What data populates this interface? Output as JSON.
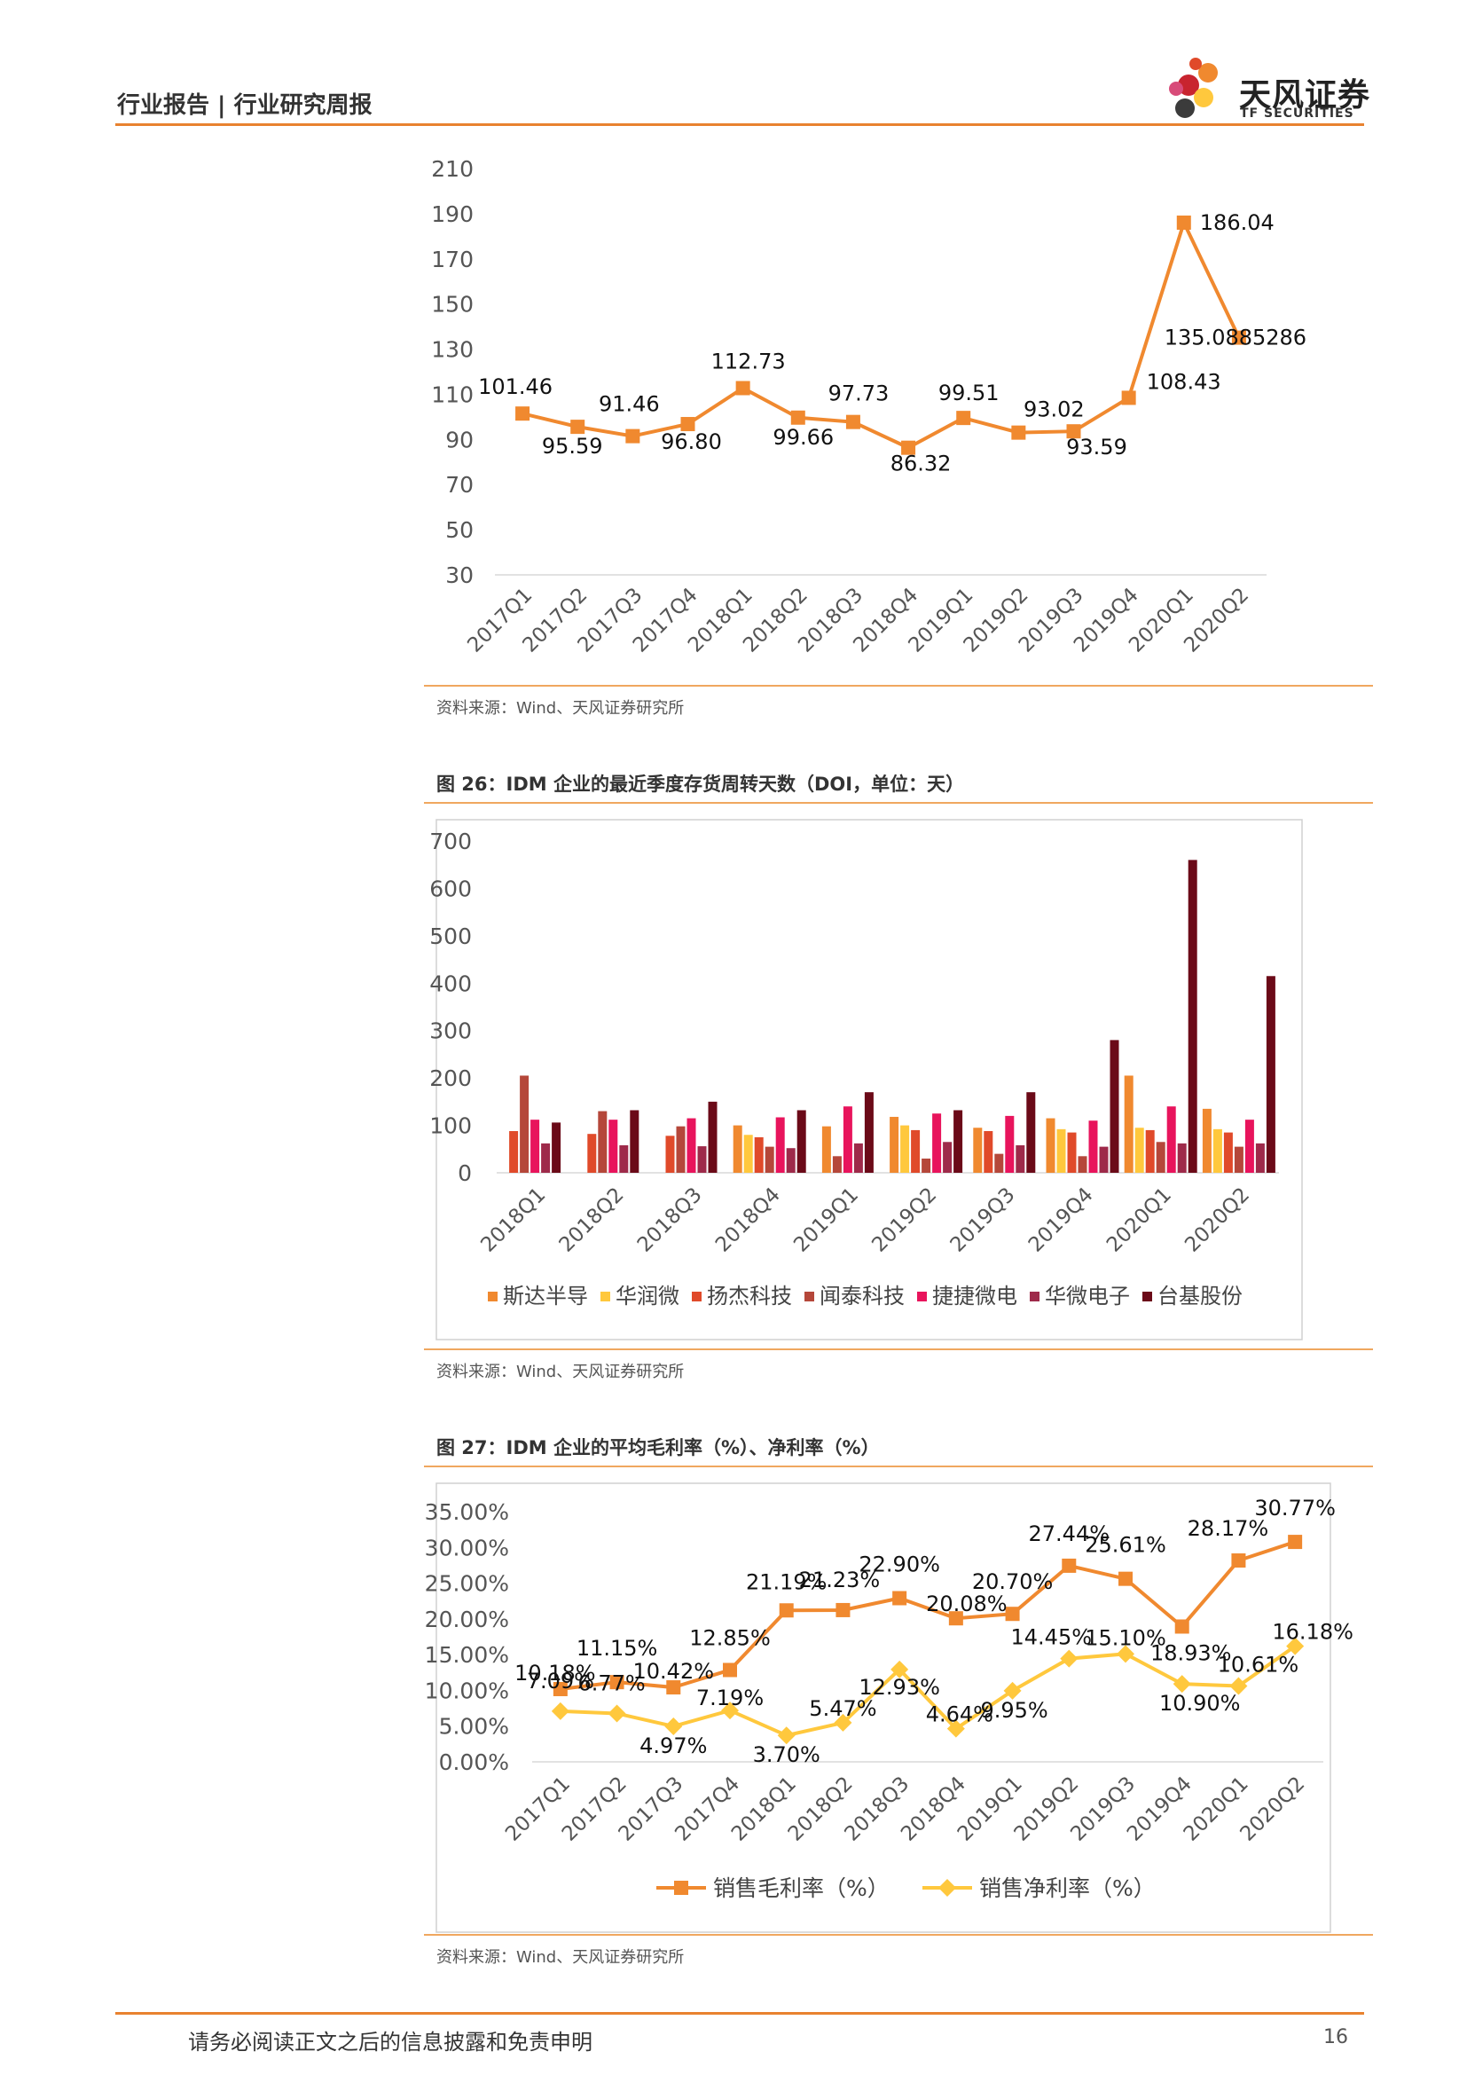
{
  "header": {
    "title": "行业报告 | 行业研究周报",
    "brand_cn": "天风证券",
    "brand_en": "TF SECURITIES",
    "rule_color": "#e8822f"
  },
  "figures": [
    {
      "source": "资料来源：Wind、天风证券研究所"
    },
    {
      "title": "图 26：IDM 企业的最近季度存货周转天数（DOI，单位：天）",
      "source": "资料来源：Wind、天风证券研究所"
    },
    {
      "title": "图 27：IDM 企业的平均毛利率（%）、净利率（%）",
      "source": "资料来源：Wind、天风证券研究所"
    }
  ],
  "chart_data": [
    {
      "type": "line",
      "x": [
        "2017Q1",
        "2017Q2",
        "2017Q3",
        "2017Q4",
        "2018Q1",
        "2018Q2",
        "2018Q3",
        "2018Q4",
        "2019Q1",
        "2019Q2",
        "2019Q3",
        "2019Q4",
        "2020Q1",
        "2020Q2"
      ],
      "series": [
        {
          "color": "#f0892f",
          "values": [
            101.46,
            95.59,
            91.46,
            96.8,
            112.73,
            99.66,
            97.73,
            86.32,
            99.51,
            93.02,
            93.59,
            108.43,
            186.04,
            135.0885286
          ],
          "labels": [
            "101.46",
            "95.59",
            "91.46",
            "96.80",
            "112.73",
            "99.66",
            "97.73",
            "86.32",
            "99.51",
            "93.02",
            "93.59",
            "108.43",
            "186.04",
            "135.0885286"
          ]
        }
      ],
      "ylim": [
        30,
        210
      ],
      "yticks": [
        30,
        50,
        70,
        90,
        110,
        130,
        150,
        170,
        190,
        210
      ],
      "grid": false,
      "legend": "none"
    },
    {
      "type": "bar",
      "categories": [
        "2018Q1",
        "2018Q2",
        "2018Q3",
        "2018Q4",
        "2019Q1",
        "2019Q2",
        "2019Q3",
        "2019Q4",
        "2020Q1",
        "2020Q2"
      ],
      "series": [
        {
          "name": "斯达半导",
          "color": "#f0892f",
          "values": [
            null,
            null,
            null,
            100,
            98,
            118,
            95,
            115,
            205,
            135
          ]
        },
        {
          "name": "华润微",
          "color": "#ffc83d",
          "values": [
            null,
            null,
            null,
            80,
            null,
            100,
            null,
            92,
            95,
            92
          ]
        },
        {
          "name": "扬杰科技",
          "color": "#e04a2a",
          "values": [
            88,
            82,
            78,
            75,
            null,
            90,
            88,
            85,
            90,
            85
          ]
        },
        {
          "name": "闻泰科技",
          "color": "#b5473a",
          "values": [
            205,
            130,
            98,
            55,
            35,
            30,
            40,
            35,
            65,
            55
          ]
        },
        {
          "name": "捷捷微电",
          "color": "#e8145c",
          "values": [
            112,
            112,
            115,
            117,
            140,
            125,
            120,
            110,
            140,
            112
          ]
        },
        {
          "name": "华微电子",
          "color": "#9e2a4a",
          "values": [
            62,
            58,
            56,
            52,
            62,
            65,
            58,
            55,
            62,
            62
          ]
        },
        {
          "name": "台基股份",
          "color": "#6b0a18",
          "values": [
            106,
            132,
            150,
            132,
            170,
            132,
            170,
            280,
            660,
            415
          ]
        }
      ],
      "ylim": [
        0,
        700
      ],
      "yticks": [
        0,
        100,
        200,
        300,
        400,
        500,
        600,
        700
      ],
      "grid": false,
      "legend": "bottom"
    },
    {
      "type": "line",
      "x": [
        "2017Q1",
        "2017Q2",
        "2017Q3",
        "2017Q4",
        "2018Q1",
        "2018Q2",
        "2018Q3",
        "2018Q4",
        "2019Q1",
        "2019Q2",
        "2019Q3",
        "2019Q4",
        "2020Q1",
        "2020Q2"
      ],
      "series": [
        {
          "name": "销售毛利率（%）",
          "color": "#f0892f",
          "marker": "square",
          "values": [
            10.18,
            11.15,
            10.42,
            12.85,
            21.19,
            21.23,
            22.9,
            20.08,
            20.7,
            27.44,
            25.61,
            18.93,
            28.17,
            30.77
          ],
          "labels": [
            "10.18%",
            "11.15%",
            "10.42%",
            "12.85%",
            "21.19%",
            "21.23%",
            "22.90%",
            "20.08%",
            "20.70%",
            "27.44%",
            "25.61%",
            "18.93%",
            "28.17%",
            "30.77%"
          ]
        },
        {
          "name": "销售净利率（%）",
          "color": "#ffc83d",
          "marker": "diamond",
          "values": [
            7.09,
            6.77,
            4.97,
            7.19,
            3.7,
            5.47,
            12.93,
            4.64,
            9.95,
            14.45,
            15.1,
            10.9,
            10.61,
            16.18
          ],
          "labels": [
            "7.09%",
            "6.77%",
            "4.97%",
            "7.19%",
            "3.70%",
            "5.47%",
            "12.93%",
            "4.64%",
            "9.95%",
            "14.45%",
            "15.10%",
            "10.90%",
            "10.61%",
            "16.18%"
          ]
        }
      ],
      "ylim": [
        0,
        35
      ],
      "yticks": [
        "0.00%",
        "5.00%",
        "10.00%",
        "15.00%",
        "20.00%",
        "25.00%",
        "30.00%",
        "35.00%"
      ],
      "grid": false,
      "legend": "bottom"
    }
  ],
  "footer": {
    "disclaimer": "请务必阅读正文之后的信息披露和免责申明",
    "page_number": "16"
  }
}
